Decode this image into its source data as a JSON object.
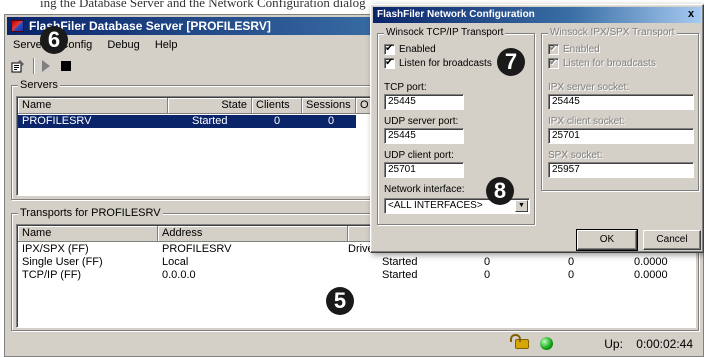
{
  "caption_text": "ing the Database Server and the Network Configuration dialog",
  "main_window": {
    "title": "FlashFiler Database Server [PROFILESRV]",
    "menu": [
      "Server",
      "Config",
      "Debug",
      "Help"
    ],
    "servers": {
      "group_title": "Servers",
      "columns": [
        "Name",
        "State",
        "Clients",
        "Sessions",
        "O"
      ],
      "rows": [
        {
          "name": "PROFILESRV",
          "state": "Started",
          "clients": "0",
          "sessions": "0",
          "open": ""
        }
      ]
    },
    "transports": {
      "group_title": "Transports for PROFILESRV",
      "columns": [
        "Name",
        "Address",
        "",
        "",
        "",
        ""
      ],
      "rows": [
        {
          "name": "IPX/SPX (FF)",
          "address": "PROFILESRV",
          "state": "Driver...",
          "c3": "",
          "c4": "",
          "c5": ""
        },
        {
          "name": "Single User (FF)",
          "address": "Local",
          "state": "Started",
          "c3": "0",
          "c4": "0",
          "c5": "0.0000"
        },
        {
          "name": "TCP/IP (FF)",
          "address": "0.0.0.0",
          "state": "Started",
          "c3": "0",
          "c4": "0",
          "c5": "0.0000"
        }
      ]
    },
    "status": {
      "uptime_label": "Up:",
      "uptime_value": "0:00:02:44"
    }
  },
  "dialog": {
    "title": "FlashFiler Network Configuration",
    "close_glyph": "x",
    "tcpip": {
      "group_title": "Winsock TCP/IP Transport",
      "enabled_label": "Enabled",
      "enabled": true,
      "broadcast_label": "Listen for broadcasts",
      "broadcast": true,
      "tcp_port_label": "TCP port:",
      "tcp_port": "25445",
      "udp_server_label": "UDP server port:",
      "udp_server": "25445",
      "udp_client_label": "UDP client port:",
      "udp_client": "25701",
      "interface_label": "Network interface:",
      "interface": "<ALL INTERFACES>"
    },
    "ipxspx": {
      "group_title": "Winsock IPX/SPX Transport",
      "enabled_label": "Enabled",
      "enabled": true,
      "broadcast_label": "Listen for broadcasts",
      "broadcast": true,
      "server_socket_label": "IPX server socket:",
      "server_socket": "25445",
      "client_socket_label": "IPX client socket:",
      "client_socket": "25701",
      "spx_socket_label": "SPX socket:",
      "spx_socket": "25957"
    },
    "ok_label": "OK",
    "cancel_label": "Cancel"
  },
  "callouts": {
    "c5": "5",
    "c6": "6",
    "c7": "7",
    "c8": "8"
  },
  "colors": {
    "title_active": "#0a246a",
    "face": "#d4d0c8",
    "selection": "#0a246a"
  }
}
